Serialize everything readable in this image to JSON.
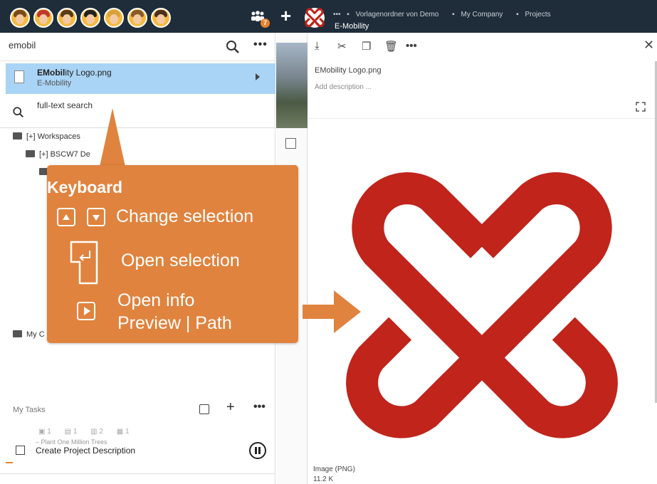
{
  "topbar": {
    "avatars": [
      "avatar-1",
      "avatar-2",
      "avatar-3",
      "avatar-4",
      "avatar-5",
      "avatar-6",
      "avatar-7"
    ],
    "badge_count": "7",
    "breadcrumbs": [
      "•••",
      "Vorlagenordner von Demo",
      "My Company",
      "Projects"
    ],
    "current_title": "E-Mobility",
    "accent": "#e9822f",
    "bar_color": "#1f2d3a"
  },
  "search": {
    "query": "emobil",
    "result": {
      "name_bold": "EMobil",
      "name_rest": "ity Logo.png",
      "subtitle": "E-Mobility"
    },
    "fulltext_label": "full-text search"
  },
  "tree": {
    "workspaces": "[+] Workspaces",
    "bscw": "[+] BSCW7 De",
    "my": "My C"
  },
  "tasks": {
    "header": "My Tasks",
    "counts": [
      "1",
      "1",
      "2",
      "1"
    ],
    "project": "– Plant One Million Trees",
    "task_name": "Create Project Description"
  },
  "detail": {
    "file_name": "EMobility Logo.png",
    "description_placeholder": "Add description ...",
    "type": "Image (PNG)",
    "size": "11.2 K",
    "logo_color": "#c0241b"
  },
  "callout": {
    "title": "Keyboard",
    "change_selection": "Change selection",
    "open_selection": "Open selection",
    "open_info": "Open info",
    "preview_path": "Preview | Path",
    "color": "#e0833e"
  }
}
